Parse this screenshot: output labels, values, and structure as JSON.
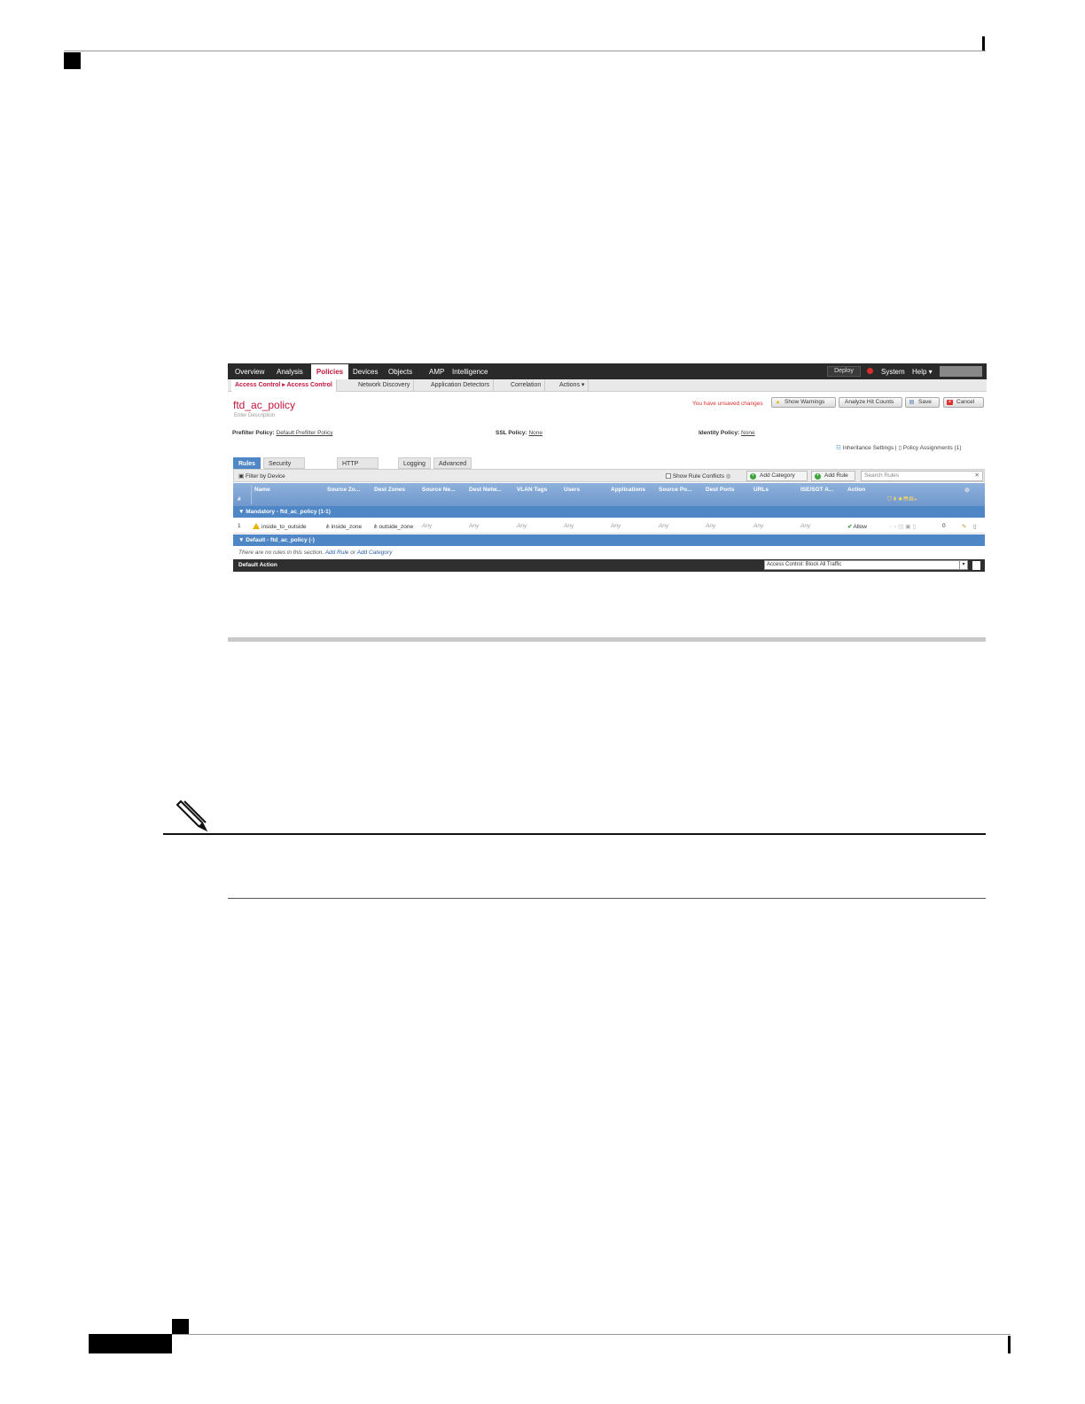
{
  "nav": {
    "items": [
      "Overview",
      "Analysis",
      "Policies",
      "Devices",
      "Objects",
      "AMP",
      "Intelligence"
    ],
    "active": "Policies",
    "deploy": "Deploy",
    "system": "System",
    "help": "Help ▾"
  },
  "subnav": {
    "items": [
      "Access Control ▸ Access Control",
      "Network Discovery",
      "Application Detectors",
      "Correlation",
      "Actions ▾"
    ]
  },
  "policy": {
    "title": "ftd_ac_policy",
    "description": "Enter Description",
    "unsaved": "You have unsaved changes",
    "buttons": {
      "show_warnings": "Show Warnings",
      "analyze": "Analyze Hit Counts",
      "save": "Save",
      "cancel": "Cancel"
    },
    "prefilter_label": "Prefilter Policy:",
    "prefilter_value": "Default Prefilter Policy",
    "ssl_label": "SSL Policy:",
    "ssl_value": "None",
    "identity_label": "Identity Policy:",
    "identity_value": "None",
    "inheritance": "Inheritance Settings |",
    "assignments": "Policy Assignments (1)"
  },
  "tabs": [
    "Rules",
    "Security Intelligence",
    "HTTP Responses",
    "Logging",
    "Advanced"
  ],
  "toolbar": {
    "filter": "Filter by Device",
    "show_conflicts": "Show Rule Conflicts",
    "add_category": "Add Category",
    "add_rule": "Add Rule",
    "search_placeholder": "Search Rules"
  },
  "table": {
    "columns": [
      "#",
      "Name",
      "Source Zo...",
      "Dest Zones",
      "Source Ne...",
      "Dest Netw...",
      "VLAN Tags",
      "Users",
      "Applications",
      "Source Po...",
      "Dest Ports",
      "URLs",
      "ISE/SGT A...",
      "Action"
    ],
    "sections": {
      "mandatory": "Mandatory - ftd_ac_policy (1-1)",
      "default": "Default - ftd_ac_policy (-)"
    },
    "row": {
      "num": "1",
      "name": "inside_to_outside",
      "src_zone": "inside_zone",
      "dst_zone": "outside_zone",
      "any": "Any",
      "action": "Allow",
      "count": "0"
    },
    "empty_msg": "There are no rules in this section.",
    "empty_add_rule": "Add Rule",
    "empty_or": "or",
    "empty_add_category": "Add Category"
  },
  "default_action": {
    "label": "Default Action",
    "value": "Access Control: Block All Traffic"
  }
}
